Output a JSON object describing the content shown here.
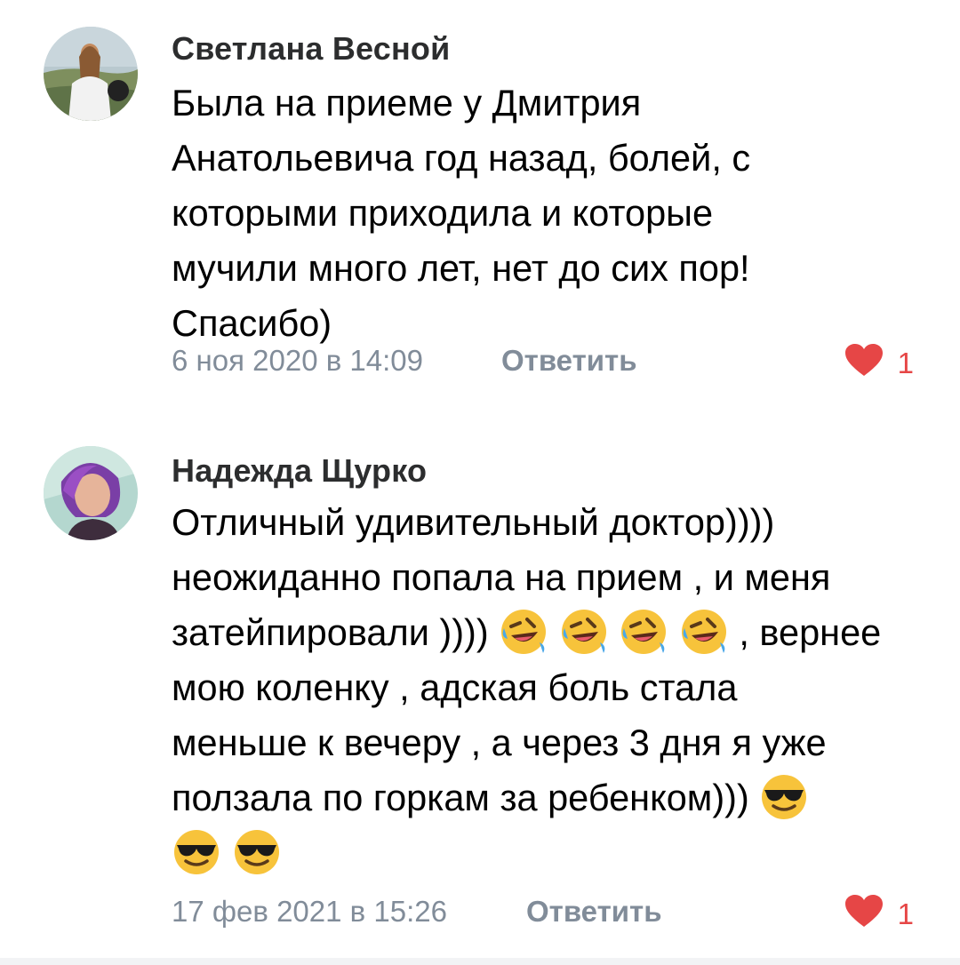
{
  "comments": [
    {
      "author": "Светлана Весной",
      "lines": [
        "Была на приеме у Дмитрия",
        "Анатольевича год назад, болей, с",
        "которыми приходила и которые",
        "мучили много лет, нет до сих пор!",
        "Спасибо)"
      ],
      "date": "6 ноя 2020 в 14:09",
      "reply_label": "Ответить",
      "likes": "1"
    },
    {
      "author": "Надежда Щурко",
      "lines": [
        "Отличный удивительный доктор))))",
        "неожиданно попала на прием , и меня",
        "затейпировали ))))",
        ", вернее",
        "мою коленку , адская боль стала",
        "меньше к вечеру , а через 3 дня я уже",
        "ползала по горкам за ребенком)))"
      ],
      "emojis": [
        "rolling-laughing-emoji",
        "sunglasses-emoji"
      ],
      "date": "17 фев 2021 в 15:26",
      "reply_label": "Ответить",
      "likes": "1"
    }
  ],
  "colors": {
    "like": "#e64646",
    "meta": "#818c99",
    "author": "#2c2d2e"
  }
}
